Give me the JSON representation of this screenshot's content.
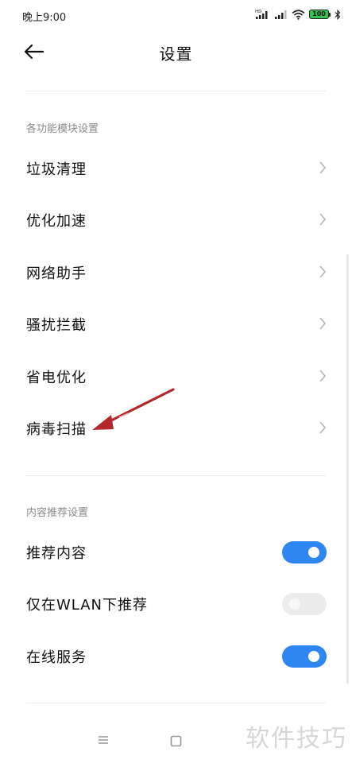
{
  "status_bar": {
    "time": "晚上9:00",
    "network_label": "HD",
    "battery_level": "100",
    "icons": [
      "signal-hd-icon",
      "signal-icon",
      "wifi-icon",
      "battery-icon",
      "bluetooth-icon"
    ]
  },
  "header": {
    "title": "设置",
    "back_icon": "back-arrow-icon"
  },
  "sections": {
    "modules": {
      "label": "各功能模块设置",
      "items": [
        {
          "label": "垃圾清理"
        },
        {
          "label": "优化加速"
        },
        {
          "label": "网络助手"
        },
        {
          "label": "骚扰拦截"
        },
        {
          "label": "省电优化"
        },
        {
          "label": "病毒扫描"
        }
      ]
    },
    "content": {
      "label": "内容推荐设置",
      "items": [
        {
          "label": "推荐内容",
          "enabled": true
        },
        {
          "label": "仅在WLAN下推荐",
          "enabled": false
        },
        {
          "label": "在线服务",
          "enabled": true
        }
      ]
    }
  },
  "colors": {
    "toggle_on": "#2e86f3",
    "toggle_off": "#ececec",
    "annotation_arrow": "#b3282d",
    "battery": "#33c24d"
  },
  "watermark": "软件技巧"
}
